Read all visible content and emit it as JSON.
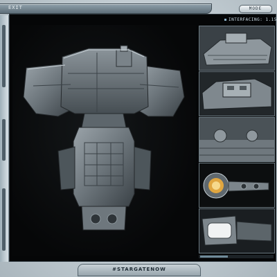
{
  "window": {
    "exit_label": "EXIT",
    "mode_label": "MODE"
  },
  "panel": {
    "status_text": "INTERFACING: 1.15",
    "hashtag": "#STARGATENOW"
  },
  "main_view": {
    "icon": "spaceship-icon"
  },
  "thumbnails": [
    {
      "icon": "ship-top-icon"
    },
    {
      "icon": "ship-bridge-icon"
    },
    {
      "icon": "ship-hull-icon"
    },
    {
      "icon": "ship-engine-icon"
    },
    {
      "icon": "ship-bay-icon"
    }
  ],
  "colors": {
    "frame": "#050607",
    "chrome": "#c3cdd3",
    "accent": "#8fb3c9"
  }
}
